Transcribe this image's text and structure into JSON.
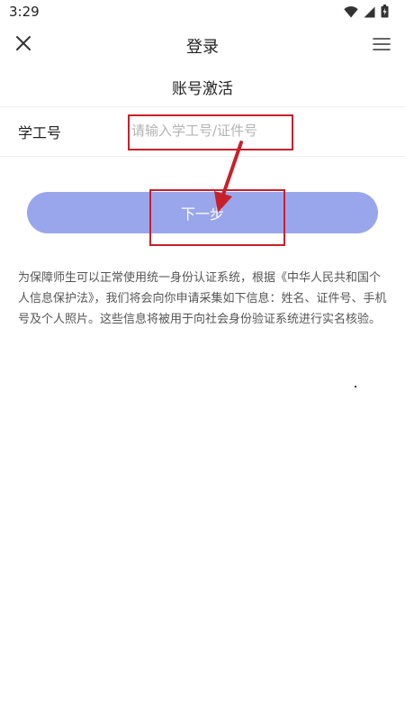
{
  "status_bar": {
    "time": "3:29",
    "icons": [
      "wifi-icon",
      "signal-icon",
      "battery-icon"
    ]
  },
  "header": {
    "title": "登录",
    "left_icon": "close-icon",
    "right_icon": "menu-icon"
  },
  "page": {
    "title": "账号激活"
  },
  "form": {
    "field_label": "学工号",
    "field_value": "",
    "field_placeholder": "请输入学工号/证件号"
  },
  "next_button": {
    "label": "下一步",
    "color": "#9aa6ec"
  },
  "notice": {
    "text": "为保障师生可以正常使用统一身份认证系统，根据《中华人民共和国个人信息保护法》，我们将会向你申请采集如下信息：姓名、证件号、手机号及个人照片。这些信息将被用于向社会身份验证系统进行实名核验。"
  },
  "annotation": {
    "color": "#c8202a"
  }
}
